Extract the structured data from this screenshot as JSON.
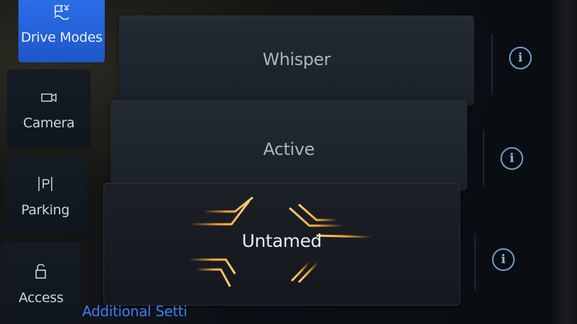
{
  "sidebar": {
    "items": [
      {
        "label": "Drive Modes",
        "icon": "drive-modes-icon",
        "active": true
      },
      {
        "label": "Camera",
        "icon": "camera-icon",
        "active": false
      },
      {
        "label": "Parking",
        "icon": "parking-icon",
        "active": false
      },
      {
        "label": "Access",
        "icon": "lock-icon",
        "active": false
      }
    ]
  },
  "modes": [
    {
      "label": "Whisper",
      "selected": false
    },
    {
      "label": "Active",
      "selected": false
    },
    {
      "label": "Untamed",
      "selected": true
    }
  ],
  "footer": {
    "additional_settings_label": "Additional Setti"
  },
  "colors": {
    "accent": "#2a6de8",
    "untamed_glow": "#f29a2e",
    "info_icon": "#6f9fd4"
  }
}
